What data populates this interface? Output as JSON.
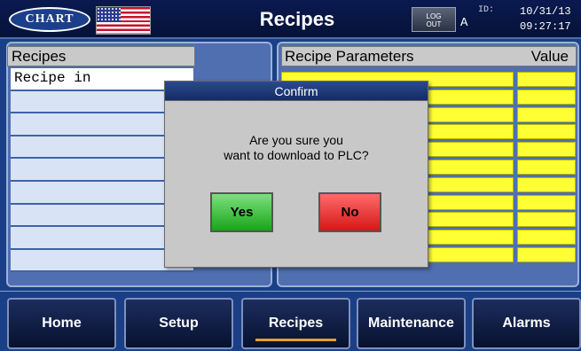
{
  "header": {
    "logo_text": "CHART",
    "title": "Recipes",
    "logout_line1": "LOG",
    "logout_line2": "OUT",
    "user_level": "A",
    "id_label": "ID:",
    "date": "10/31/13",
    "time": "09:27:17"
  },
  "recipes_panel": {
    "header": "Recipes",
    "rows": [
      "Recipe in",
      "",
      "",
      "",
      "",
      "",
      "",
      "",
      ""
    ]
  },
  "params_panel": {
    "header_name": "Recipe Parameters",
    "header_value": "Value",
    "row_count": 11
  },
  "dialog": {
    "title": "Confirm",
    "message_line1": "Are you sure you",
    "message_line2": "want to download to PLC?",
    "yes_label": "Yes",
    "no_label": "No"
  },
  "nav": {
    "items": [
      {
        "label": "Home",
        "active": false
      },
      {
        "label": "Setup",
        "active": false
      },
      {
        "label": "Recipes",
        "active": true
      },
      {
        "label": "Maintenance",
        "active": false
      },
      {
        "label": "Alarms",
        "active": false
      }
    ]
  },
  "colors": {
    "background": "#1a3f86",
    "param_cell": "#ffff33",
    "yes_button": "#19a519",
    "no_button": "#d41818",
    "active_underline": "#e8a020"
  }
}
